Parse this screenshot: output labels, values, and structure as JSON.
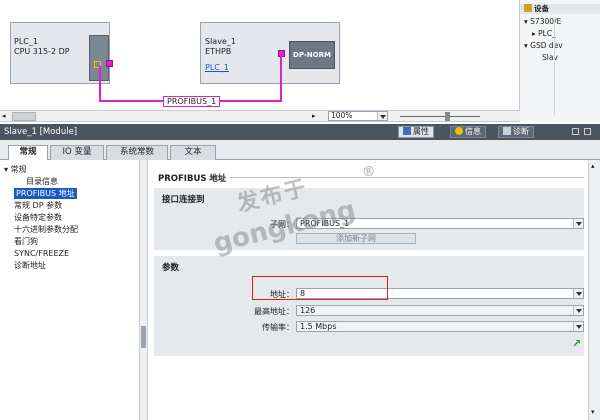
{
  "network": {
    "plc": {
      "name": "PLC_1",
      "type": "CPU 315-2 DP"
    },
    "slave": {
      "name": "Slave_1",
      "type": "ETHPB",
      "link": "PLC_1",
      "module": "DP-NORM"
    },
    "bus_label": "PROFIBUS_1",
    "zoom": "100%"
  },
  "tree": {
    "title": "设备",
    "items": [
      "S7300/E",
      "PLC_",
      "GSD dev",
      "Slav"
    ]
  },
  "inspector": {
    "title": "Slave_1 [Module]",
    "tabs": [
      "属性",
      "信息",
      "诊断"
    ]
  },
  "tabs": [
    "常规",
    "IO 变量",
    "系统常数",
    "文本"
  ],
  "nav": {
    "items": [
      "常规",
      "目录信息",
      "PROFIBUS 地址",
      "常规 DP 参数",
      "设备特定参数",
      "十六进制参数分配",
      "看门狗",
      "SYNC/FREEZE",
      "诊断地址"
    ],
    "selected": 2
  },
  "content": {
    "section_title": "PROFIBUS 地址",
    "interface": {
      "heading": "接口连接到",
      "subnet_label": "子网：",
      "subnet_value": "PROFIBUS_1",
      "add_subnet_button": "添加新子网"
    },
    "params": {
      "heading": "参数",
      "address_label": "地址：",
      "address_value": "8",
      "highest_label": "最高地址：",
      "highest_value": "126",
      "rate_label": "传输率：",
      "rate_value": "1.5 Mbps"
    }
  },
  "watermark": {
    "cn": "发布于",
    "en": "gongkong",
    "mark": "®"
  },
  "colors": {
    "profibus": "#e020c8",
    "selection": "#1a58c2",
    "highlight": "#e02020"
  }
}
